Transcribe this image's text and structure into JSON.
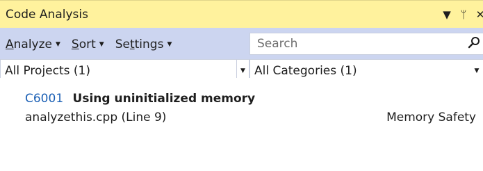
{
  "window": {
    "title": "Code Analysis",
    "buttons": {
      "dropdown": "▼",
      "pin": "ᛘ",
      "close": "✕"
    }
  },
  "toolbar": {
    "menus": [
      {
        "prefix": "",
        "underline": "A",
        "suffix": "nalyze",
        "arrow": "▼"
      },
      {
        "prefix": "",
        "underline": "S",
        "suffix": "ort",
        "arrow": "▼"
      },
      {
        "prefix": "Se",
        "underline": "t",
        "suffix": "tings",
        "arrow": "▼"
      }
    ],
    "search": {
      "placeholder": "Search",
      "icon": "search-icon"
    }
  },
  "filters": {
    "projects": {
      "value": "All Projects (1)",
      "arrow": "▼"
    },
    "categories": {
      "value": "All Categories (1)",
      "arrow": "▼"
    }
  },
  "results": [
    {
      "code": "C6001",
      "description": "Using uninitialized memory",
      "location": "analyzethis.cpp (Line 9)",
      "category": "Memory Safety"
    }
  ],
  "colors": {
    "title_bg": "#fff29d",
    "toolbar_bg": "#ccd5f0",
    "link": "#1a5fb4"
  }
}
